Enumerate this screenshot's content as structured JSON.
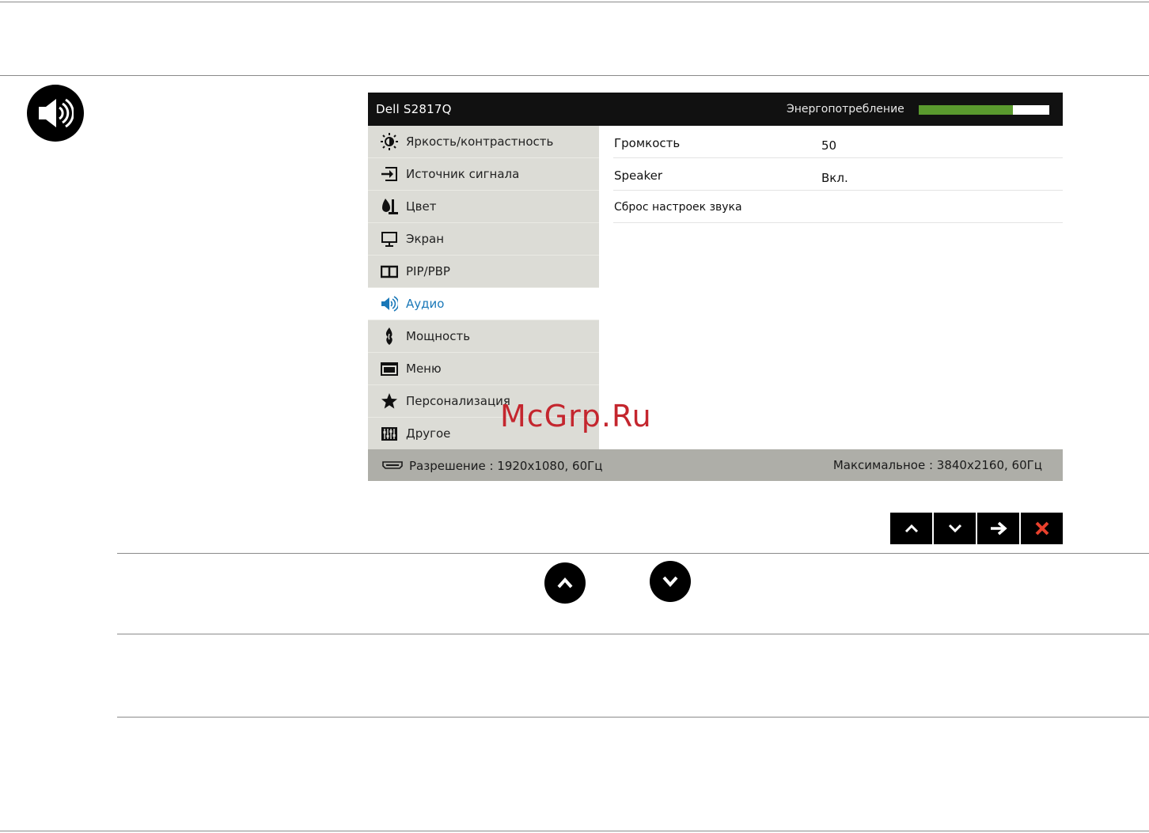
{
  "osd": {
    "title": "Dell S2817Q",
    "energy_label": "Энергопотребление",
    "energy_level": 0.72,
    "menu": [
      {
        "label": "Яркость/контрастность",
        "icon": "brightness-icon",
        "active": false
      },
      {
        "label": "Источник сигнала",
        "icon": "input-source-icon",
        "active": false
      },
      {
        "label": "Цвет",
        "icon": "color-icon",
        "active": false
      },
      {
        "label": "Экран",
        "icon": "display-icon",
        "active": false
      },
      {
        "label": "PIP/PBP",
        "icon": "pip-icon",
        "active": false
      },
      {
        "label": "Аудио",
        "icon": "audio-icon",
        "active": true
      },
      {
        "label": "Мощность",
        "icon": "power-icon",
        "active": false
      },
      {
        "label": "Меню",
        "icon": "menu-icon",
        "active": false
      },
      {
        "label": "Персонализация",
        "icon": "star-icon",
        "active": false
      },
      {
        "label": "Другое",
        "icon": "other-icon",
        "active": false
      }
    ],
    "submenu": [
      {
        "label": "Громкость",
        "value": "50"
      },
      {
        "label": "Speaker",
        "value": "Вкл."
      },
      {
        "label": "Сброс настроек звука",
        "value": ""
      }
    ],
    "footer": {
      "resolution": "Разрешение : 1920x1080, 60Гц",
      "max": "Максимальное : 3840x2160, 60Гц"
    },
    "colors": {
      "accent": "#1a78b8",
      "energy": "#5a9a2e",
      "close": "#e8402c"
    }
  },
  "watermark": "McGrp.Ru"
}
